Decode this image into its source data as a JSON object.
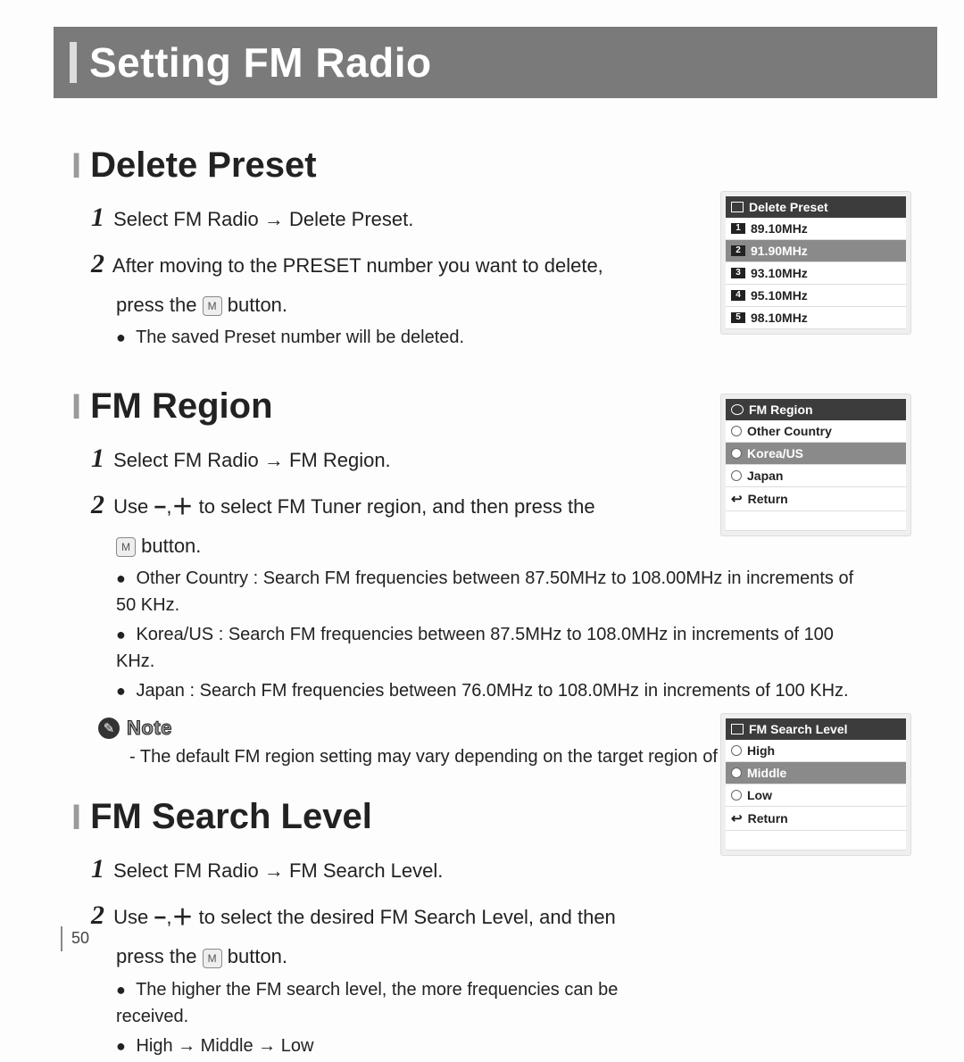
{
  "page_number": "50",
  "header": {
    "title": "Setting FM Radio"
  },
  "sections": {
    "delete": {
      "heading": "Delete Preset",
      "step1": "Select FM Radio → Delete Preset.",
      "step2a": "After moving to the PRESET number you want to delete,",
      "step2b_before": "press the",
      "step2b_after": "button.",
      "bullet1": "The saved Preset number will be deleted.",
      "screen": {
        "title": "Delete Preset",
        "rows": [
          {
            "num": "1",
            "label": "89.10MHz",
            "sel": false
          },
          {
            "num": "2",
            "label": "91.90MHz",
            "sel": true
          },
          {
            "num": "3",
            "label": "93.10MHz",
            "sel": false
          },
          {
            "num": "4",
            "label": "95.10MHz",
            "sel": false
          },
          {
            "num": "5",
            "label": "98.10MHz",
            "sel": false
          }
        ]
      }
    },
    "region": {
      "heading": "FM Region",
      "step1": "Select FM Radio → FM Region.",
      "step2a_before": "Use",
      "step2a_after": "to select FM Tuner region, and then press the",
      "step2b_after": "button.",
      "bul1": "Other Country : Search FM frequencies between 87.50MHz to 108.00MHz in increments of 50 KHz.",
      "bul2": "Korea/US : Search FM frequencies between 87.5MHz to 108.0MHz in increments of 100 KHz.",
      "bul3": "Japan : Search FM frequencies between 76.0MHz to 108.0MHz in increments of 100 KHz.",
      "note_label": "Note",
      "note_text": "- The default FM region setting may vary depending on the target region of the player.",
      "screen": {
        "title": "FM Region",
        "rows": [
          {
            "label": "Other Country",
            "sel": false
          },
          {
            "label": "Korea/US",
            "sel": true
          },
          {
            "label": "Japan",
            "sel": false
          },
          {
            "label": "Return",
            "sel": false,
            "ret": true
          }
        ]
      }
    },
    "search": {
      "heading": "FM Search Level",
      "step1": "Select FM Radio → FM Search Level.",
      "step2a_before": "Use",
      "step2a_after": "to select the desired FM Search Level, and then",
      "step2b_before": "press the",
      "step2b_after": "button.",
      "bul1": "The higher the FM search level, the more frequencies can be received.",
      "bul2": "High → Middle → Low",
      "screen": {
        "title": "FM Search Level",
        "rows": [
          {
            "label": "High",
            "sel": false
          },
          {
            "label": "Middle",
            "sel": true
          },
          {
            "label": "Low",
            "sel": false
          },
          {
            "label": "Return",
            "sel": false,
            "ret": true
          }
        ]
      }
    }
  },
  "glyphs": {
    "m_button": "M",
    "minus": "−",
    "plus": "＋",
    "comma": ","
  }
}
